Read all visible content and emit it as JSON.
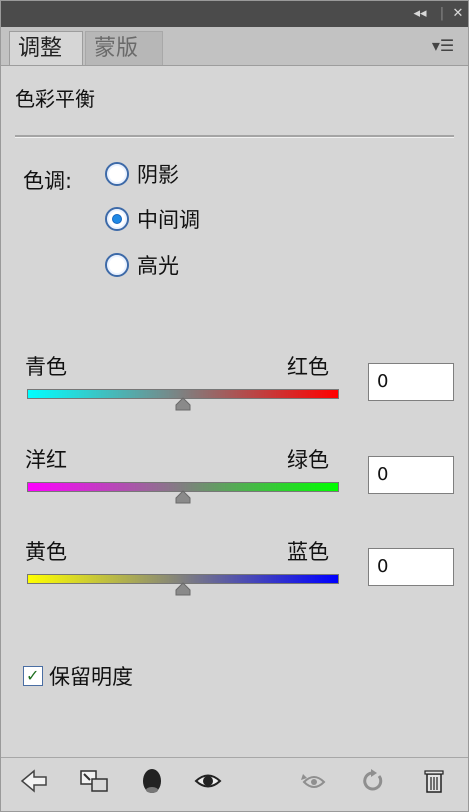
{
  "titlebar": {
    "collapse_icon": "double-chevron-left-icon",
    "close_icon": "close-icon"
  },
  "tabs": [
    {
      "label": "调整",
      "active": true
    },
    {
      "label": "蒙版",
      "active": false
    }
  ],
  "panel_menu_icon": "panel-menu-icon",
  "panel_title": "色彩平衡",
  "tone": {
    "label": "色调:",
    "options": [
      {
        "label": "阴影",
        "checked": false
      },
      {
        "label": "中间调",
        "checked": true
      },
      {
        "label": "高光",
        "checked": false
      }
    ]
  },
  "sliders": [
    {
      "left": "青色",
      "right": "红色",
      "value": "0",
      "from": "#00ffff",
      "to": "#ff0000"
    },
    {
      "left": "洋红",
      "right": "绿色",
      "value": "0",
      "from": "#ff00ff",
      "to": "#00ff00"
    },
    {
      "left": "黄色",
      "right": "蓝色",
      "value": "0",
      "from": "#ffff00",
      "to": "#0000ff"
    }
  ],
  "preserve_luminosity": {
    "label": "保留明度",
    "checked": true
  },
  "footer_icons": [
    "back-arrow-icon",
    "clip-to-layer-icon",
    "mask-view-icon",
    "eye-icon",
    "previous-state-icon",
    "reset-icon",
    "trash-icon"
  ]
}
